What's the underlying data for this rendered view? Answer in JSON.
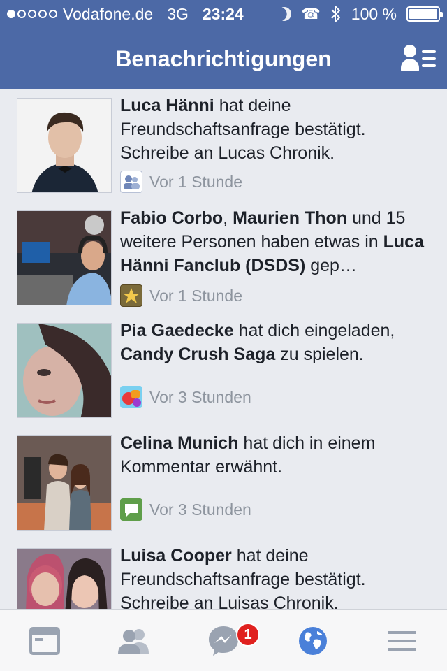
{
  "status": {
    "carrier": "Vodafone.de",
    "network": "3G",
    "time": "23:24",
    "battery": "100 %",
    "icons": [
      "moon-icon",
      "phone-icon",
      "bluetooth-icon",
      "battery-icon"
    ]
  },
  "nav": {
    "title": "Benachrichtigungen",
    "right_icon": "friend-requests-icon"
  },
  "notifications": [
    {
      "actor1": "Luca Hänni",
      "text1": " hat deine Freundschaftsanfrage bestätigt. Schreibe an Lucas Chronik.",
      "actor2": "",
      "text2": "",
      "target": "",
      "text3": "",
      "time": "Vor 1 Stunde",
      "icon": "friends-icon"
    },
    {
      "actor1": "Fabio Corbo",
      "text1": ", ",
      "actor2": "Maurien Thon",
      "text2": " und 15 weitere Personen haben etwas in ",
      "target": "Luca Hänni Fanclub (DSDS)",
      "text3": " gep…",
      "time": "Vor 1 Stunde",
      "icon": "star-icon"
    },
    {
      "actor1": "Pia Gaedecke",
      "text1": " hat dich eingeladen, ",
      "actor2": "Candy Crush Saga",
      "text2": " zu spielen.",
      "target": "",
      "text3": "",
      "time": "Vor 3 Stunden",
      "icon": "candy-crush-icon"
    },
    {
      "actor1": "Celina Munich",
      "text1": " hat dich in einem Kommentar erwähnt.",
      "actor2": "",
      "text2": "",
      "target": "",
      "text3": "",
      "time": "Vor 3 Stunden",
      "icon": "comment-icon"
    },
    {
      "actor1": "Luisa Cooper",
      "text1": " hat deine Freundschaftsanfrage bestätigt. Schreibe an Luisas Chronik.",
      "actor2": "",
      "text2": "",
      "target": "",
      "text3": "",
      "time": "",
      "icon": ""
    }
  ],
  "tabbar": {
    "tabs": [
      "news-feed-icon",
      "friends-icon",
      "messenger-icon",
      "notifications-globe-icon",
      "menu-icon"
    ],
    "messages_badge": "1",
    "active": "notifications-globe-icon"
  },
  "colors": {
    "brand": "#4c69a6",
    "background": "#e9ebf0",
    "badge": "#e0211f",
    "active_tab": "#4a80d9",
    "inactive_tab": "#9aa3b1"
  }
}
